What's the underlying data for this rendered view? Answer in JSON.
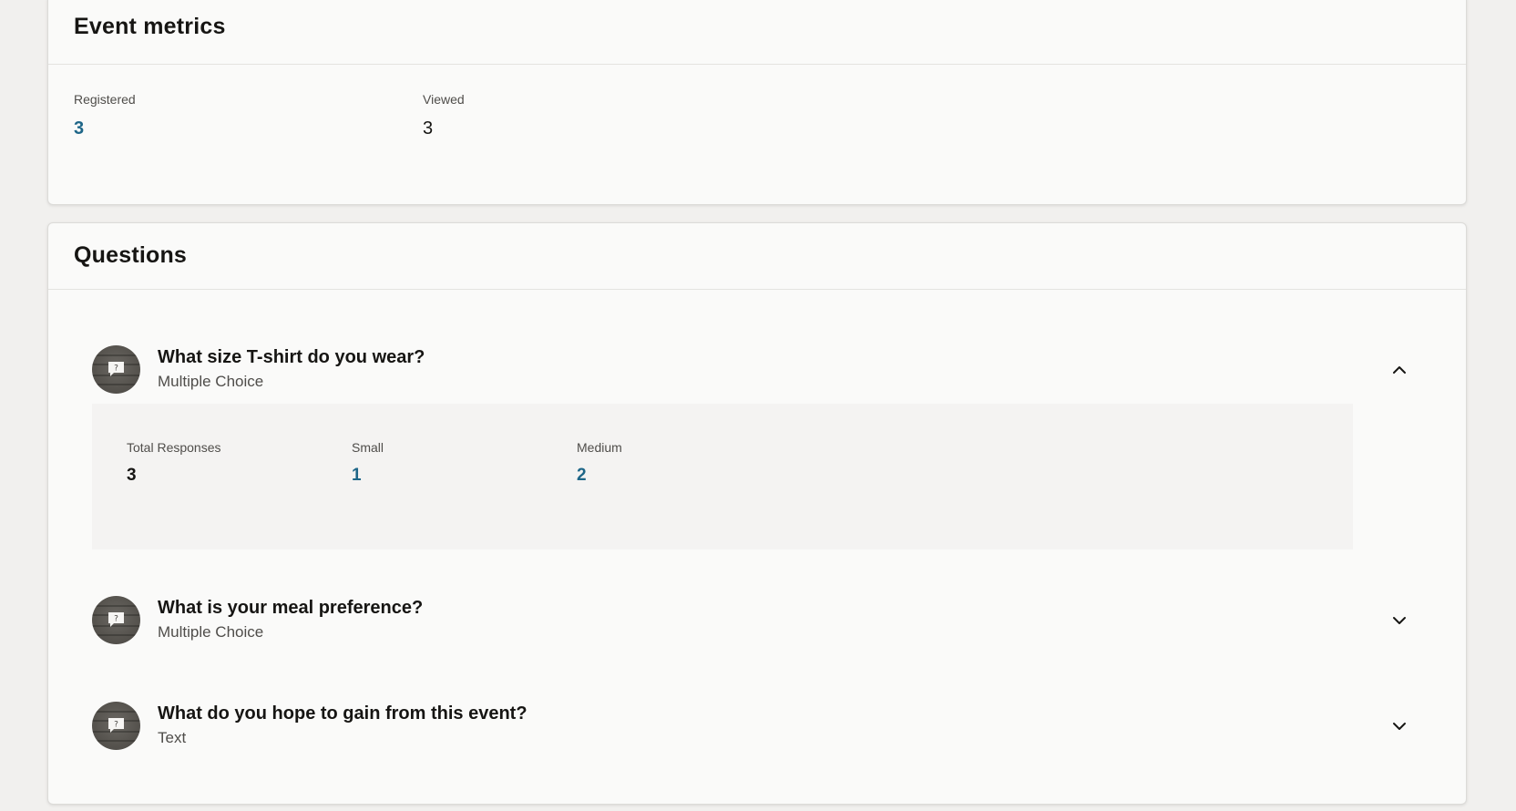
{
  "event_metrics": {
    "title": "Event metrics",
    "registered": {
      "label": "Registered",
      "value": "3"
    },
    "viewed": {
      "label": "Viewed",
      "value": "3"
    }
  },
  "questions": {
    "title": "Questions",
    "items": [
      {
        "title": "What size T-shirt do you wear?",
        "type": "Multiple Choice",
        "expanded": true,
        "icon": "chevron-up-icon",
        "results": {
          "total": {
            "label": "Total Responses",
            "value": "3"
          },
          "options": [
            {
              "label": "Small",
              "value": "1"
            },
            {
              "label": "Medium",
              "value": "2"
            }
          ]
        }
      },
      {
        "title": "What is your meal preference?",
        "type": "Multiple Choice",
        "expanded": false,
        "icon": "chevron-down-icon"
      },
      {
        "title": "What do you hope to gain from this event?",
        "type": "Text",
        "expanded": false,
        "icon": "chevron-down-icon"
      }
    ]
  },
  "colors": {
    "link": "#1e6688",
    "card_bg": "#fafaf9",
    "page_bg": "#f1f0ee",
    "panel_bg": "#f4f3f2"
  }
}
